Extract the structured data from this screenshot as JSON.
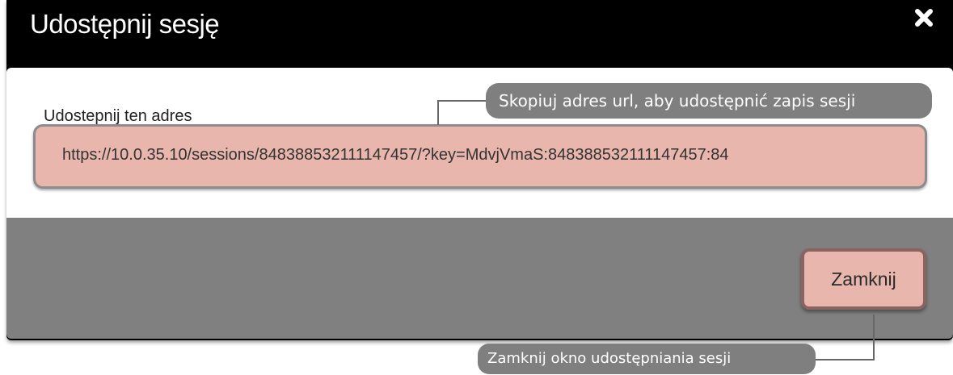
{
  "dialog": {
    "title": "Udostępnij sesję",
    "close_icon": "close-x-icon",
    "field_label": "Udostepnij ten adres",
    "url_value": "https://10.0.35.10/sessions/848388532111147457/?key=MdvjVmaS:848388532111147457:84",
    "close_button_label": "Zamknij"
  },
  "annotations": {
    "url_callout": "Skopiuj adres url, aby udostępnić zapis sesji",
    "close_callout": "Zamknij okno udostępniania sesji"
  },
  "colors": {
    "titlebar": "#000000",
    "field_fill": "#e8b6ac",
    "footer": "#808080",
    "callout": "#7f7f7f"
  }
}
